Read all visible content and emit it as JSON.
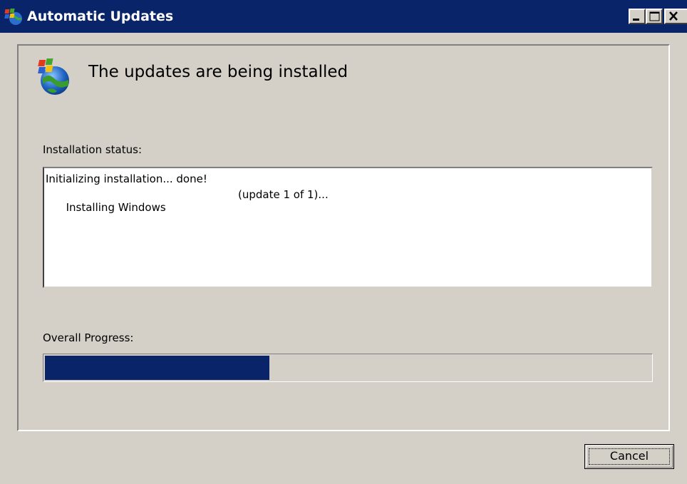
{
  "window": {
    "title": "Automatic Updates",
    "icon": "windows-update-icon"
  },
  "titlebar_buttons": {
    "minimize_icon": "minimize-icon",
    "maximize_icon": "maximize-icon",
    "close_icon": "close-icon"
  },
  "header": {
    "icon": "windows-update-globe-icon",
    "title": "The updates are being installed"
  },
  "status": {
    "label": "Installation status:",
    "lines": [
      "Initializing installation... done!",
      "Installing Windows"
    ],
    "update_count": "(update 1 of 1)..."
  },
  "progress": {
    "label": "Overall Progress:",
    "fraction": 0.37
  },
  "buttons": {
    "cancel_label": "Cancel"
  },
  "colors": {
    "titlebar": "#0a246a",
    "face": "#d4d0c8",
    "progress_fill": "#0a246a"
  }
}
